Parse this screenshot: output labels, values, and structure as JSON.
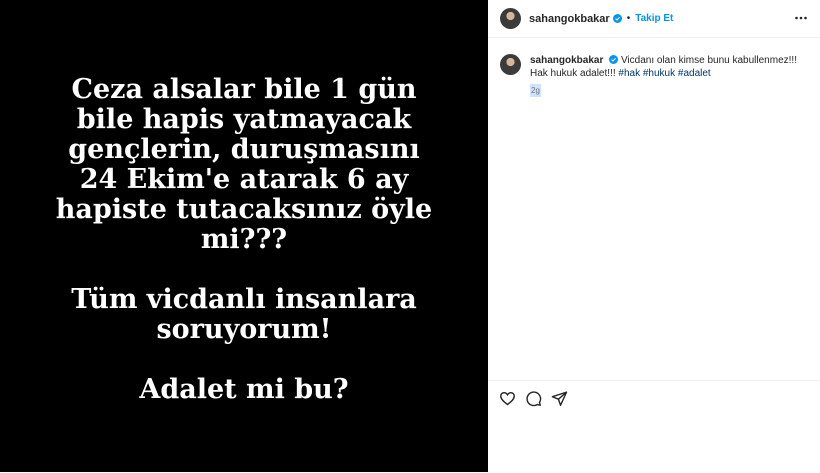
{
  "post": {
    "image_text": {
      "line1": "Ceza alsalar bile 1 gün",
      "line2": "bile hapis yatmayacak",
      "line3": "gençlerin, duruşmasını",
      "line4": "24 Ekim'e atarak 6 ay",
      "line5": "hapiste tutacaksınız öyle",
      "line6": "mi???",
      "line7": "Tüm vicdanlı insanlara",
      "line8": "soruyorum!",
      "line9": "Adalet mi bu?"
    }
  },
  "header": {
    "username": "sahangokbakar",
    "separator": "•",
    "follow_label": "Takip Et"
  },
  "caption": {
    "username": "sahangokbakar",
    "text": "Vicdanı olan kimse bunu kabullenmez!!! Hak hukuk adalet!!!",
    "hashtags": [
      "#hak",
      "#hukuk",
      "#adalet"
    ],
    "time": "2g"
  },
  "icons": {
    "verified": "verified-badge-icon",
    "more": "more-options-icon",
    "like": "heart-icon",
    "comment": "comment-icon",
    "share": "share-icon"
  },
  "colors": {
    "accent": "#0095f6",
    "hashtag": "#00376b",
    "verified": "#0095f6",
    "image_bg": "#000000"
  }
}
